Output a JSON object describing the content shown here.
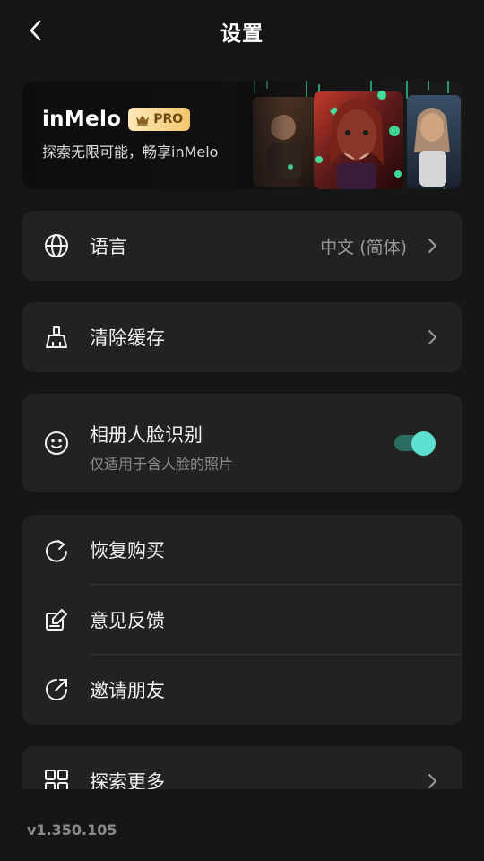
{
  "header": {
    "title": "设置"
  },
  "banner": {
    "brand": "inMelo",
    "badge": "PRO",
    "subtitle": "探索无限可能，畅享inMelo"
  },
  "settings": {
    "language": {
      "label": "语言",
      "value": "中文 (简体)",
      "icon": "globe-icon"
    },
    "clear_cache": {
      "label": "清除缓存",
      "icon": "broom-icon"
    },
    "face_recognition": {
      "label": "相册人脸识别",
      "sublabel": "仅适用于含人脸的照片",
      "icon": "smiley-face-icon",
      "enabled": true
    },
    "restore_purchase": {
      "label": "恢复购买",
      "icon": "refresh-icon"
    },
    "feedback": {
      "label": "意见反馈",
      "icon": "edit-note-icon"
    },
    "invite_friends": {
      "label": "邀请朋友",
      "icon": "share-arrow-icon"
    },
    "explore_more": {
      "label": "探索更多",
      "icon": "grid-icon"
    }
  },
  "footer": {
    "version": "v1.350.105"
  },
  "colors": {
    "background": "#161616",
    "card": "#222222",
    "accent": "#5ee0d0",
    "toggle_track": "#2a6b62",
    "badge_gold": "#f4c66d"
  }
}
